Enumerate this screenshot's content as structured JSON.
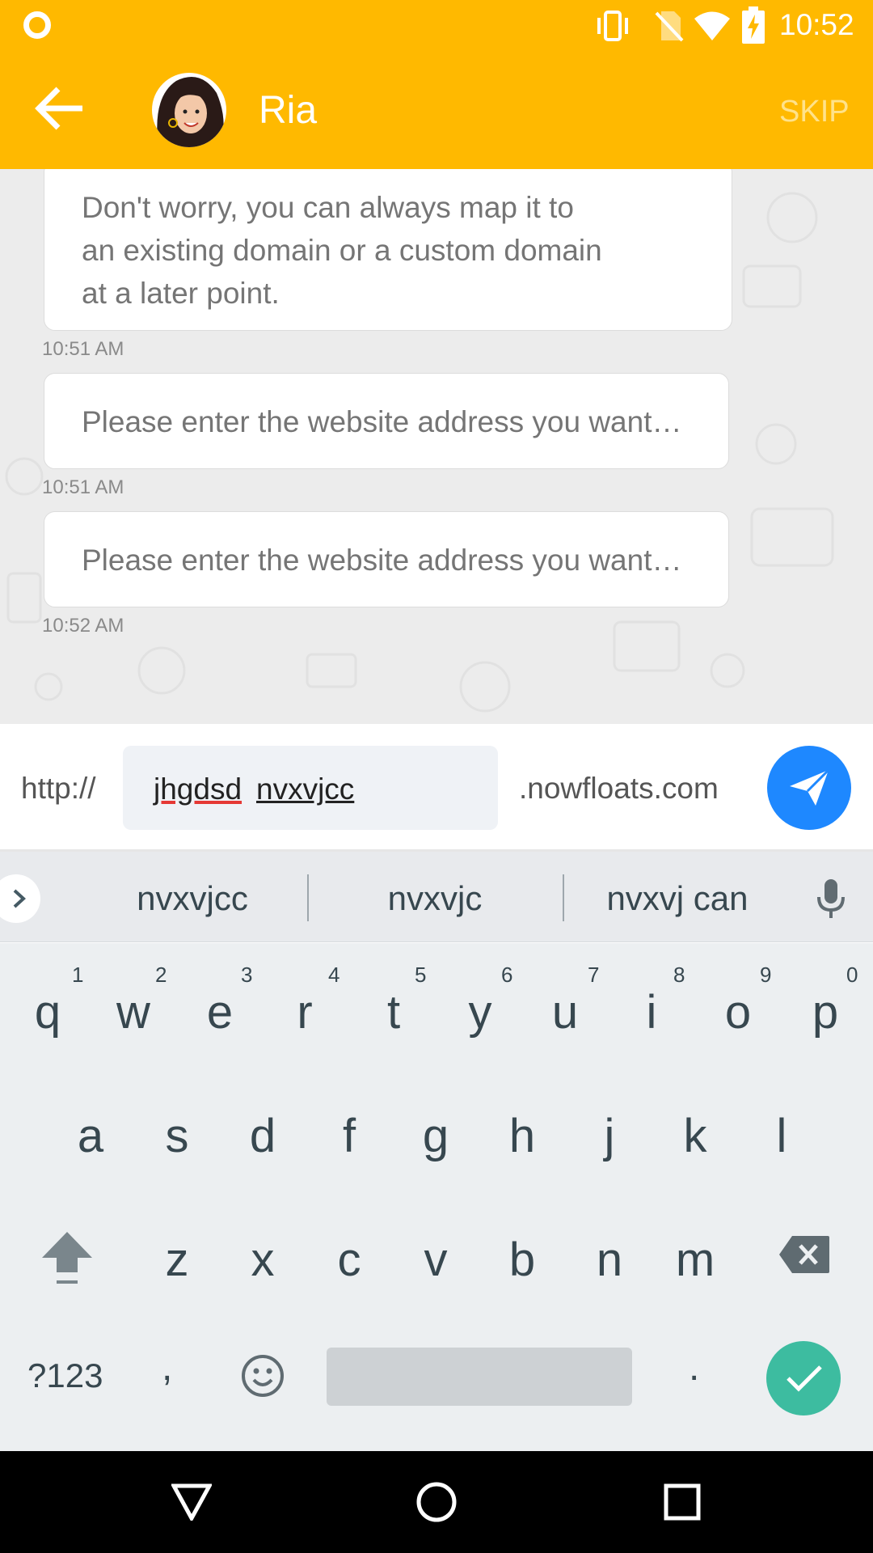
{
  "status_bar": {
    "time": "10:52",
    "icons": [
      "record-icon",
      "vibrate-icon",
      "no-sim-icon",
      "wifi-icon",
      "battery-charging-icon"
    ]
  },
  "app_bar": {
    "title": "Ria",
    "skip_label": "SKIP",
    "back_icon": "arrow-back-icon",
    "avatar": "ria-avatar",
    "bg_color": "#FFB900"
  },
  "messages": [
    {
      "lines": [
        "Don't worry, you can always map it to",
        "an existing domain or a custom domain",
        "at a later point."
      ],
      "time": "10:51 AM"
    },
    {
      "lines": [
        "Please enter the website address you want…"
      ],
      "time": "10:51 AM"
    },
    {
      "lines": [
        "Please enter the website address you want…"
      ],
      "time": "10:52 AM"
    }
  ],
  "input_bar": {
    "prefix": "http://",
    "word1": "jhgdsd",
    "word2": "nvxvjcc",
    "suffix": ".nowfloats.com",
    "send_icon": "send-icon",
    "send_color": "#1E88FF"
  },
  "suggestions": {
    "items": [
      "nvxvjcc",
      "nvxvjc",
      "nvxvj can"
    ],
    "expand_icon": "chevron-right-icon",
    "mic_icon": "mic-icon"
  },
  "keyboard": {
    "row1": [
      "q",
      "w",
      "e",
      "r",
      "t",
      "y",
      "u",
      "i",
      "o",
      "p"
    ],
    "row1_hints": [
      "1",
      "2",
      "3",
      "4",
      "5",
      "6",
      "7",
      "8",
      "9",
      "0"
    ],
    "row2": [
      "a",
      "s",
      "d",
      "f",
      "g",
      "h",
      "j",
      "k",
      "l"
    ],
    "row3": [
      "z",
      "x",
      "c",
      "v",
      "b",
      "n",
      "m"
    ],
    "symbols_label": "?123",
    "comma": ",",
    "period": ".",
    "shift_icon": "shift-icon",
    "backspace_icon": "backspace-icon",
    "emoji_icon": "emoji-icon",
    "enter_icon": "check-icon",
    "enter_color": "#3DBCA0"
  },
  "nav_bar": {
    "icons": [
      "back-triangle-icon",
      "home-circle-icon",
      "recents-square-icon"
    ]
  }
}
